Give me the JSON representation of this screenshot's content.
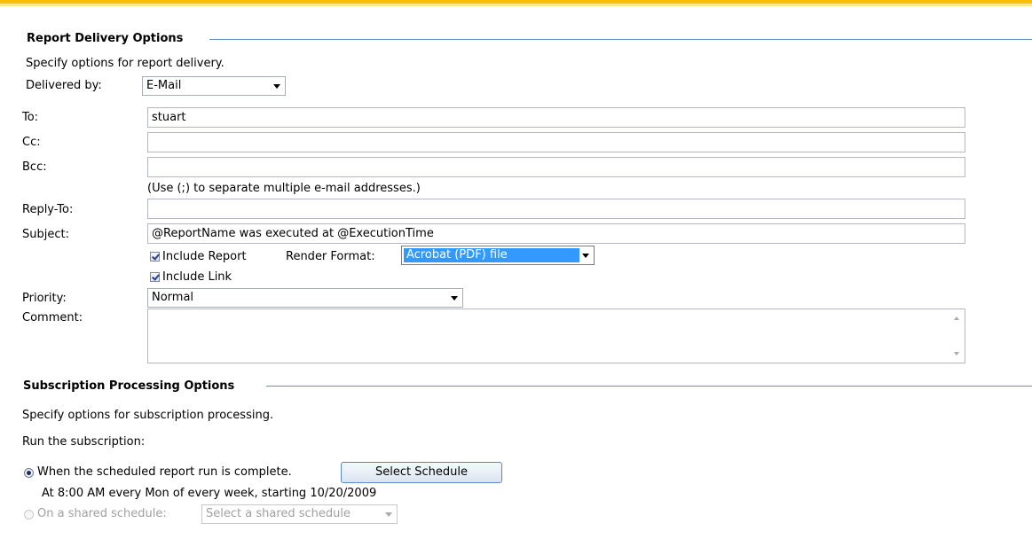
{
  "delivery": {
    "section_title": "Report Delivery Options",
    "description": "Specify options for report delivery.",
    "delivered_by_label": "Delivered by:",
    "delivered_by_value": "E-Mail",
    "to_label": "To:",
    "to_value": "stuart",
    "cc_label": "Cc:",
    "cc_value": "",
    "bcc_label": "Bcc:",
    "bcc_value": "",
    "separator_hint": "(Use (;) to separate multiple e-mail addresses.)",
    "reply_to_label": "Reply-To:",
    "reply_to_value": "",
    "subject_label": "Subject:",
    "subject_value": "@ReportName was executed at @ExecutionTime",
    "include_report_label": "Include Report",
    "include_report_checked": true,
    "render_format_label": "Render Format:",
    "render_format_value": "Acrobat (PDF) file",
    "include_link_label": "Include Link",
    "include_link_checked": true,
    "priority_label": "Priority:",
    "priority_value": "Normal",
    "comment_label": "Comment:",
    "comment_value": ""
  },
  "processing": {
    "section_title": "Subscription Processing Options",
    "description": "Specify options for subscription processing.",
    "run_label": "Run the subscription:",
    "option_scheduled_label": "When the scheduled report run is complete.",
    "option_scheduled_selected": true,
    "select_schedule_button": "Select Schedule",
    "schedule_summary": "At 8:00 AM every Mon of every week, starting 10/20/2009",
    "option_shared_label": "On a shared schedule:",
    "option_shared_selected": false,
    "shared_schedule_placeholder": "Select a shared schedule"
  },
  "colors": {
    "accent_bar": "#f2c200",
    "section_rule": "#6d8fc4",
    "selection_highlight": "#3399ff"
  }
}
